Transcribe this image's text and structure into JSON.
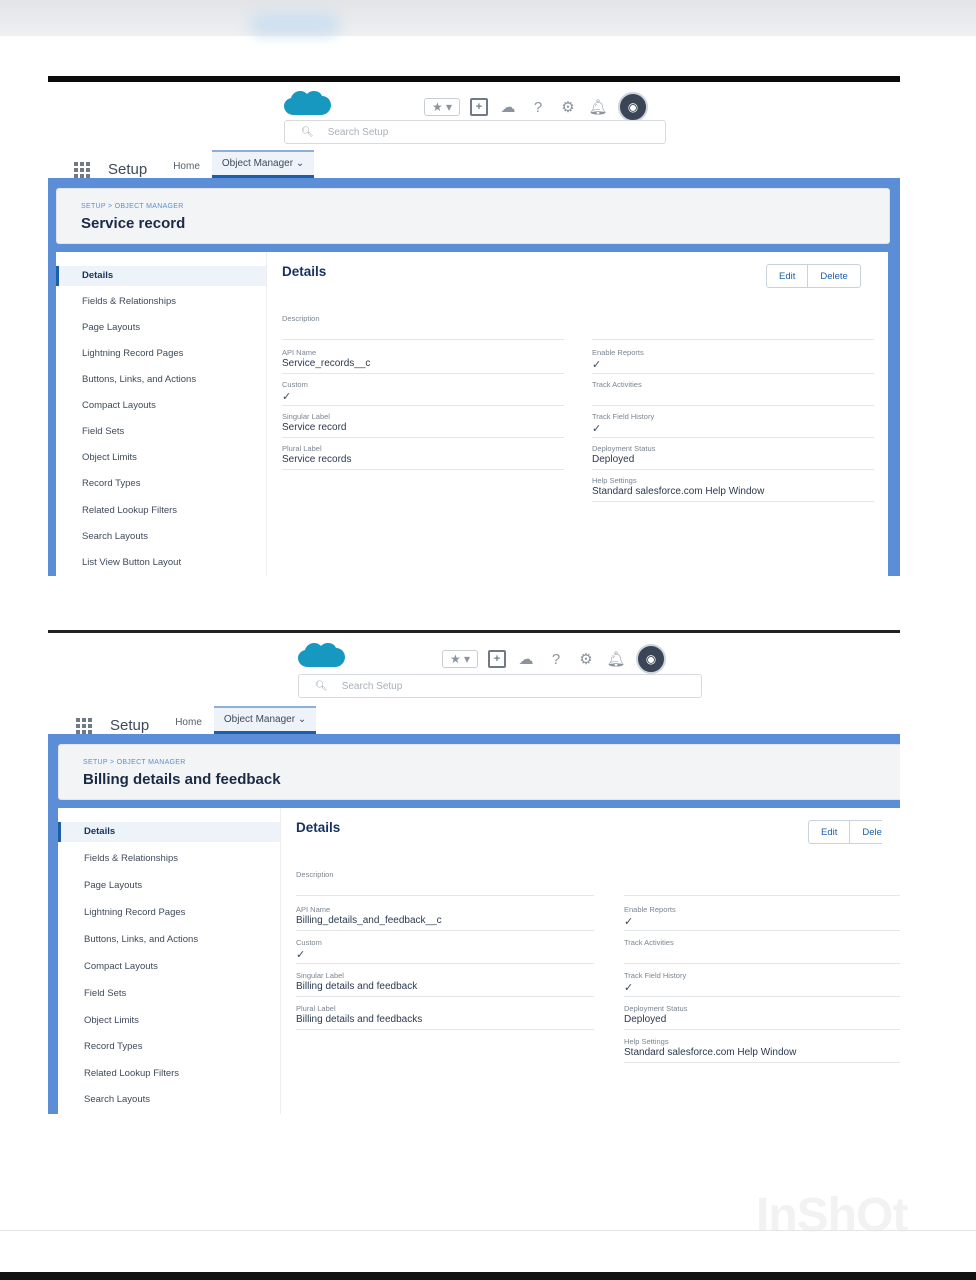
{
  "header": {
    "search_placeholder": "Search Setup",
    "icons": [
      "salesforce-cloud-logo",
      "favorites-star-icon",
      "add-icon",
      "trailhead-icon",
      "help-icon",
      "gear-icon",
      "notifications-bell-icon",
      "avatar"
    ],
    "app_name": "Setup",
    "tabs": [
      "Home",
      "Object Manager"
    ]
  },
  "panels": [
    {
      "breadcrumb": "SETUP > OBJECT MANAGER",
      "title": "Service record",
      "sidebar": [
        "Details",
        "Fields & Relationships",
        "Page Layouts",
        "Lightning Record Pages",
        "Buttons, Links, and Actions",
        "Compact Layouts",
        "Field Sets",
        "Object Limits",
        "Record Types",
        "Related Lookup Filters",
        "Search Layouts",
        "List View Button Layout"
      ],
      "details_title": "Details",
      "edit_label": "Edit",
      "delete_label": "Delete",
      "description_label": "Description",
      "left_fields": [
        {
          "label": "API Name",
          "value": "Service_records__c"
        },
        {
          "label": "Custom",
          "value": "✓"
        },
        {
          "label": "Singular Label",
          "value": "Service record"
        },
        {
          "label": "Plural Label",
          "value": "Service records"
        }
      ],
      "right_fields": [
        {
          "label": "Enable Reports",
          "value": "✓"
        },
        {
          "label": "Track Activities",
          "value": ""
        },
        {
          "label": "Track Field History",
          "value": "✓"
        },
        {
          "label": "Deployment Status",
          "value": "Deployed"
        },
        {
          "label": "Help Settings",
          "value": "Standard salesforce.com Help Window"
        }
      ]
    },
    {
      "breadcrumb": "SETUP > OBJECT MANAGER",
      "title": "Billing details and feedback",
      "sidebar": [
        "Details",
        "Fields & Relationships",
        "Page Layouts",
        "Lightning Record Pages",
        "Buttons, Links, and Actions",
        "Compact Layouts",
        "Field Sets",
        "Object Limits",
        "Record Types",
        "Related Lookup Filters",
        "Search Layouts"
      ],
      "details_title": "Details",
      "edit_label": "Edit",
      "delete_label": "Dele",
      "description_label": "Description",
      "left_fields": [
        {
          "label": "API Name",
          "value": "Billing_details_and_feedback__c"
        },
        {
          "label": "Custom",
          "value": "✓"
        },
        {
          "label": "Singular Label",
          "value": "Billing details and feedback"
        },
        {
          "label": "Plural Label",
          "value": "Billing details and feedbacks"
        }
      ],
      "right_fields": [
        {
          "label": "Enable Reports",
          "value": "✓"
        },
        {
          "label": "Track Activities",
          "value": ""
        },
        {
          "label": "Track Field History",
          "value": "✓"
        },
        {
          "label": "Deployment Status",
          "value": "Deployed"
        },
        {
          "label": "Help Settings",
          "value": "Standard salesforce.com Help Window"
        }
      ]
    }
  ],
  "watermark": "InShOt",
  "colors": {
    "brand_blue": "#1b5faa",
    "page_blue": "#5b8ed6",
    "cloud": "#1798c1"
  }
}
